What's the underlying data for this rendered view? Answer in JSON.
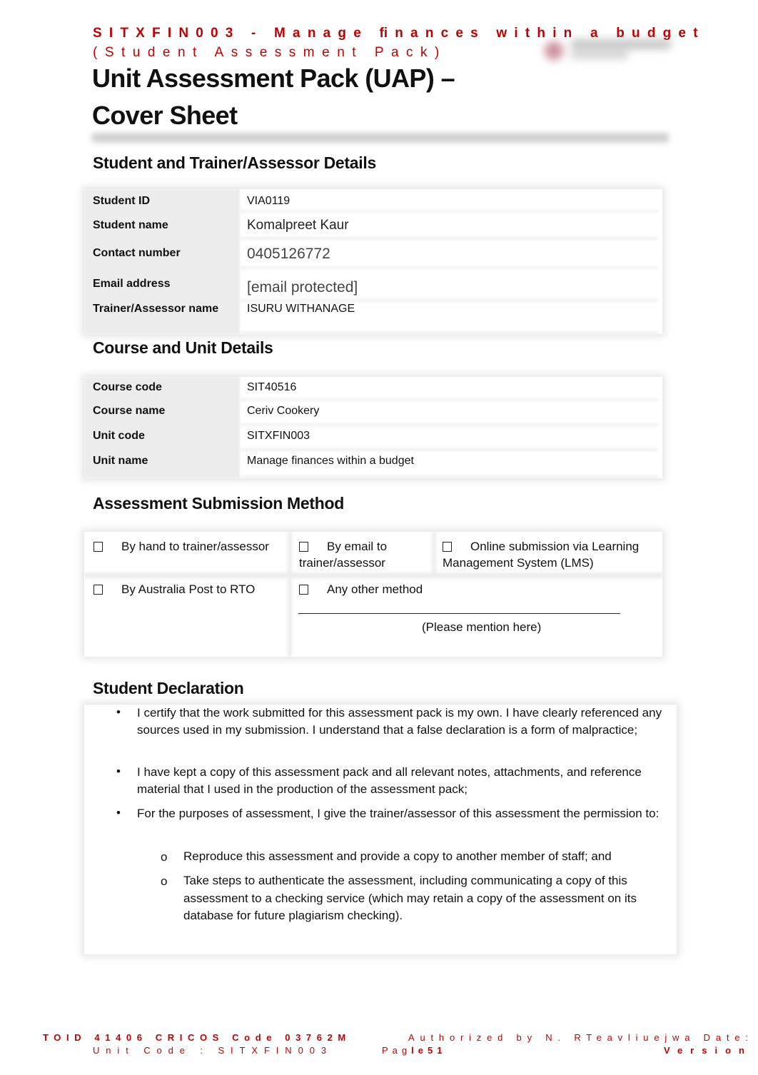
{
  "header": {
    "unit_line": "SITXFIN003 - Manage ﬁnances within a budget",
    "pack_line": "(Student Assessment Pack)",
    "logo": "institution-logo-blurred"
  },
  "title": {
    "line1": "Unit Assessment Pack (UAP) –",
    "line2": "Cover Sheet"
  },
  "student_section": {
    "heading": "Student and Trainer/Assessor Details",
    "rows": [
      {
        "label": "Student ID",
        "value": "VIA0119"
      },
      {
        "label": "Student name",
        "value": "Komalpreet Kaur"
      },
      {
        "label": "Contact number",
        "value": "0405126772"
      },
      {
        "label": "Email address",
        "value": "[email protected]"
      },
      {
        "label": "Trainer/Assessor name",
        "value": "ISURU WITHANAGE"
      }
    ]
  },
  "course_section": {
    "heading": "Course and Unit Details",
    "rows": [
      {
        "label": "Course code",
        "value": "SIT40516"
      },
      {
        "label": "Course name",
        "value": "Ceriv Cookery"
      },
      {
        "label": "Unit code",
        "value": "SITXFIN003"
      },
      {
        "label": "Unit name",
        "value": "Manage finances within a budget"
      }
    ]
  },
  "submission_section": {
    "heading": "Assessment Submission Method",
    "options": [
      {
        "label": "By hand to trainer/assessor",
        "checked": false
      },
      {
        "label": "By email to trainer/assessor",
        "line1": "By email to",
        "line2": "trainer/assessor",
        "checked": false
      },
      {
        "label": "Online submission via Learning Management System (LMS)",
        "line1": "Online submission via Learning",
        "line2": "Management System (LMS)",
        "checked": false
      },
      {
        "label": "By Australia Post to RTO",
        "checked": false
      },
      {
        "label": "Any other method",
        "checked": false
      }
    ],
    "other_blank": "______________________________________________________",
    "other_hint": "(Please mention here)"
  },
  "declaration": {
    "heading": "Student Declaration",
    "bullets": [
      "I certify that the work submitted for this assessment pack is my own. I have clearly referenced any sources used in my submission. I understand that a false declaration is a form of malpractice;",
      "I have kept a copy of this assessment pack and all relevant notes, attachments, and reference material that I used in the production of the assessment pack;",
      "For the purposes of assessment, I give the trainer/assessor of this assessment the permission to:"
    ],
    "sub_bullets": [
      "Reproduce this assessment and provide a copy to another member of staff; and",
      "Take steps to authenticate the assessment, including communicating a copy of this assessment to a checking service (which may retain a copy of the assessment on its database for future plagiarism checking)."
    ],
    "bullet_glyph": "•",
    "sub_bullet_glyph": "o"
  },
  "footer": {
    "toid": "TOID 41406 CRICOS Code 03762M",
    "authorized": "Authorized by N. RTeavliuejwa Date: July",
    "unit_code": "Unit Code : SITXFIN003",
    "page_prefix": "Pag",
    "page_number": "le51",
    "version": "Version"
  },
  "colors": {
    "accent_red": "#c00000",
    "label_shade": "#ececec"
  }
}
